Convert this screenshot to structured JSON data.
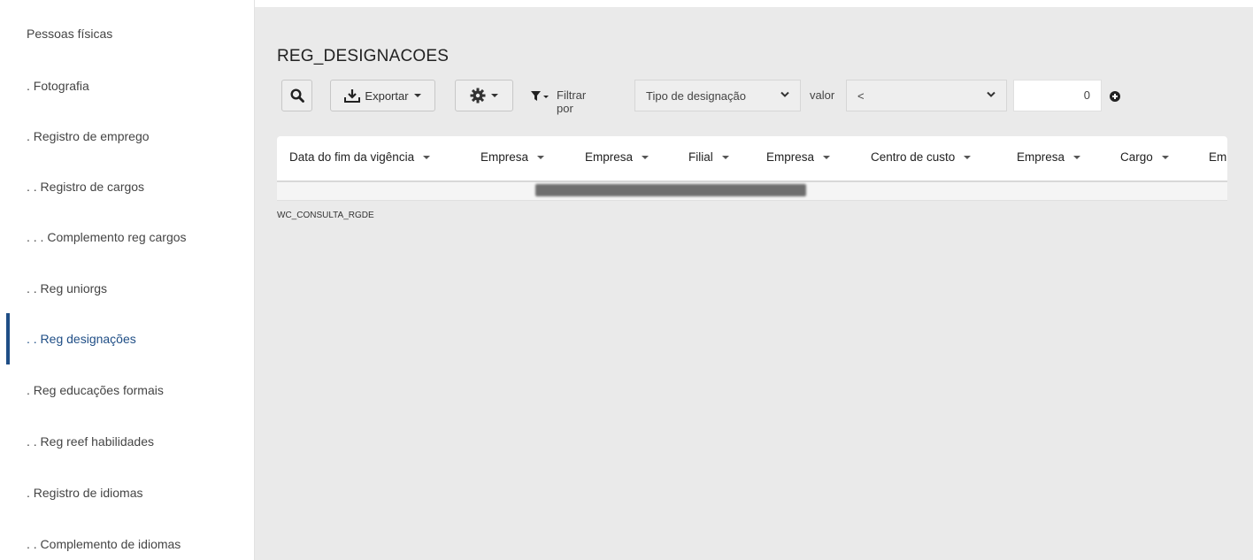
{
  "sidebar": {
    "items": [
      {
        "label": "Pessoas físicas"
      },
      {
        "label": ". Fotografia"
      },
      {
        "label": ". Registro de emprego"
      },
      {
        "label": ". . Registro de cargos"
      },
      {
        "label": ". . . Complemento reg cargos"
      },
      {
        "label": ". . Reg uniorgs"
      },
      {
        "label": ". . Reg designações",
        "active": true
      },
      {
        "label": ". Reg educações formais"
      },
      {
        "label": ". . Reg reef habilidades"
      },
      {
        "label": ". Registro de idiomas"
      },
      {
        "label": ". . Complemento de idiomas"
      }
    ]
  },
  "main": {
    "title": "REG_DESIGNACOES",
    "toolbar": {
      "export_label": "Exportar",
      "filter_label": "Filtrar por",
      "filter_field": "Tipo de designação",
      "value_label": "valor",
      "operator": "<",
      "value": "0"
    },
    "table": {
      "columns": [
        "Data do fim da vigência",
        "Empresa",
        "Empresa",
        "Filial",
        "Empresa",
        "Centro de custo",
        "Empresa",
        "Cargo",
        "Em"
      ]
    },
    "consult_label": "WC_CONSULTA_RGDE"
  },
  "colors": {
    "accent": "#1f4e86",
    "main_bg": "#eaeaea"
  }
}
